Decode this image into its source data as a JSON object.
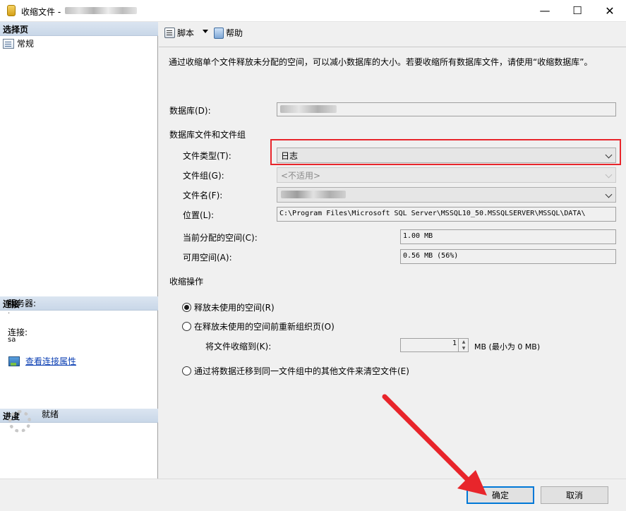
{
  "window": {
    "title": "收缩文件 - ",
    "minimize": "—",
    "maximize": "☐",
    "close": "✕"
  },
  "left_pane": {
    "select_page_header": "选择页",
    "pages": [
      {
        "label": "常规",
        "icon": "page-icon"
      }
    ],
    "connection_header": "连接",
    "server_label": "服务器:",
    "server_value": ".",
    "connection_label": "连接:",
    "connection_value": "sa",
    "view_connection_properties": "查看连接属性",
    "progress_header": "进度",
    "status": "就绪"
  },
  "toolbar": {
    "script_label": "脚本",
    "help_label": "帮助"
  },
  "form": {
    "description": "通过收缩单个文件释放未分配的空间，可以减小数据库的大小。若要收缩所有数据库文件，请使用“收缩数据库”。",
    "database_label": "数据库(D):",
    "files_group_label": "数据库文件和文件组",
    "file_type_label": "文件类型(T):",
    "file_type_value": "日志",
    "filegroup_label": "文件组(G):",
    "filegroup_value": "<不适用>",
    "filename_label": "文件名(F):",
    "location_label": "位置(L):",
    "location_value": "C:\\Program Files\\Microsoft SQL Server\\MSSQL10_50.MSSQLSERVER\\MSSQL\\DATA\\",
    "allocated_label": "当前分配的空间(C):",
    "allocated_value": "1.00 MB",
    "free_label": "可用空间(A):",
    "free_value": "0.56 MB (56%)",
    "shrink_ops_label": "收缩操作",
    "option1": "释放未使用的空间(R)",
    "option2": "在释放未使用的空间前重新组织页(O)",
    "shrink_to_label": "将文件收缩到(K):",
    "shrink_to_value": "1",
    "shrink_to_unit": "MB (最小为 0 MB)",
    "option3": "通过将数据迁移到同一文件组中的其他文件来清空文件(E)"
  },
  "buttons": {
    "ok": "确定",
    "cancel": "取消"
  },
  "colors": {
    "highlight_box": "#e8252b",
    "annotation_arrow": "#e8252b",
    "link": "#0b3fb3"
  }
}
